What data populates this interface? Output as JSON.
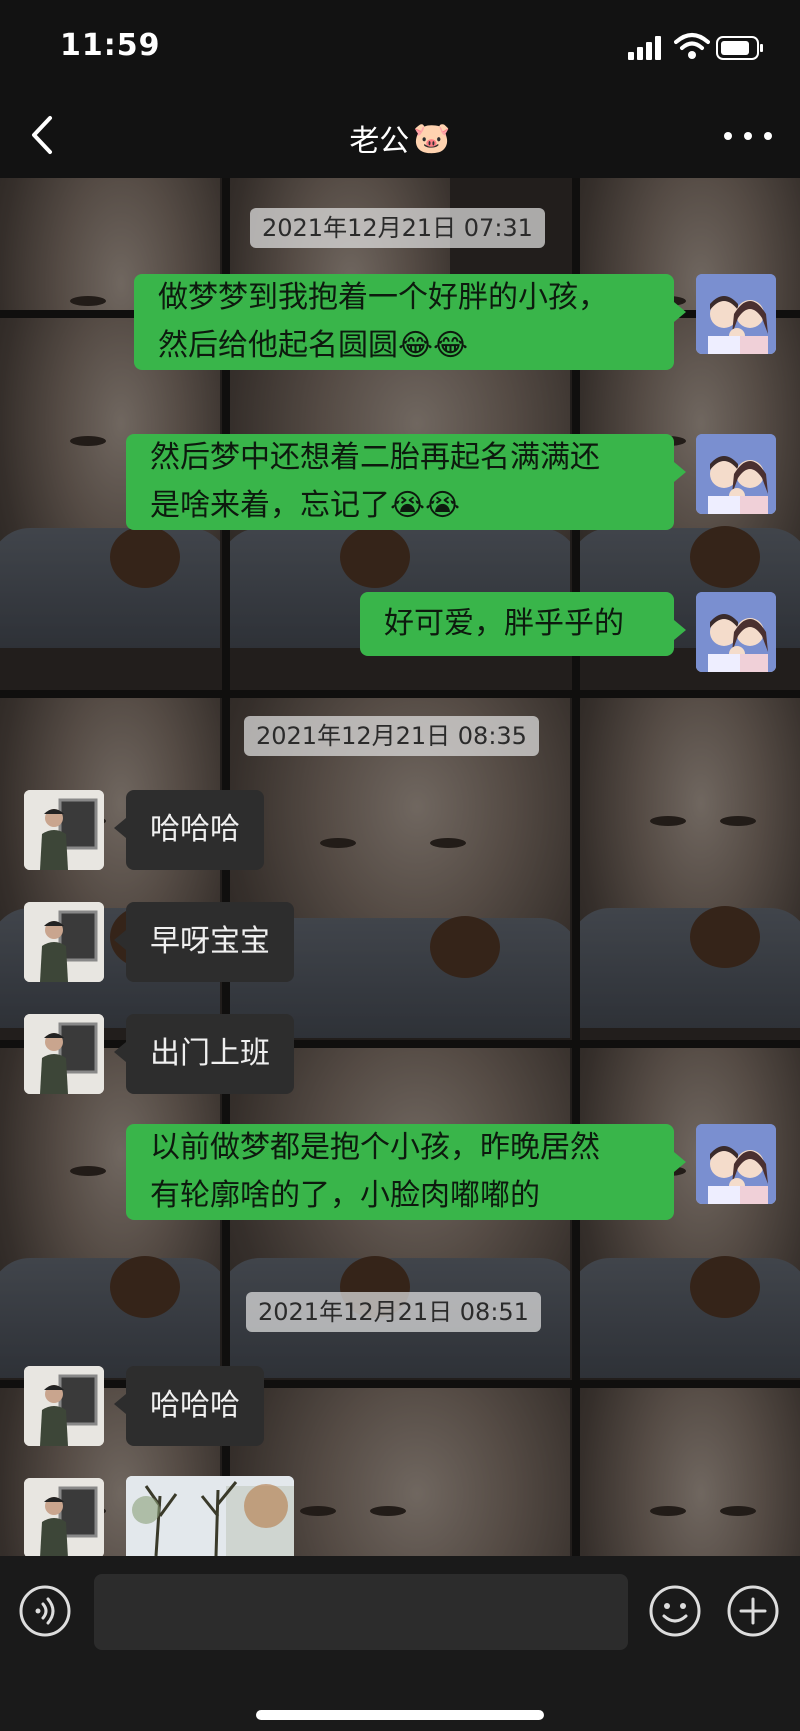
{
  "status_bar": {
    "time": "11:59"
  },
  "nav": {
    "title": "老公",
    "title_emoji": "🐷"
  },
  "messages": [
    {
      "type": "timestamp",
      "text": "2021年12月21日 07:31"
    },
    {
      "type": "out",
      "line1": "做梦梦到我抱着一个好胖的小孩，",
      "line2": "然后给他起名圆圆",
      "emoji": "😂😂"
    },
    {
      "type": "out",
      "line1": "然后梦中还想着二胎再起名满满还",
      "line2": "是啥来着，忘记了",
      "emoji": "😭😭"
    },
    {
      "type": "out",
      "text": "好可爱，胖乎乎的"
    },
    {
      "type": "timestamp",
      "text": "2021年12月21日 08:35"
    },
    {
      "type": "in",
      "text": "哈哈哈"
    },
    {
      "type": "in",
      "text": "早呀宝宝"
    },
    {
      "type": "in",
      "text": "出门上班"
    },
    {
      "type": "out",
      "line1": "以前做梦都是抱个小孩，昨晚居然",
      "line2": "有轮廓啥的了，小脸肉嘟嘟的"
    },
    {
      "type": "timestamp",
      "text": "2021年12月21日 08:51"
    },
    {
      "type": "in",
      "text": "哈哈哈"
    },
    {
      "type": "in-image",
      "image": "tree-photo"
    }
  ],
  "input_bar": {
    "voice_icon": "voice-icon",
    "emoji_icon": "emoji-icon",
    "plus_icon": "plus-icon",
    "placeholder": ""
  },
  "colors": {
    "outgoing_bubble": "#39b54a",
    "incoming_bubble": "#2d2d2d",
    "bar": "#121212"
  }
}
